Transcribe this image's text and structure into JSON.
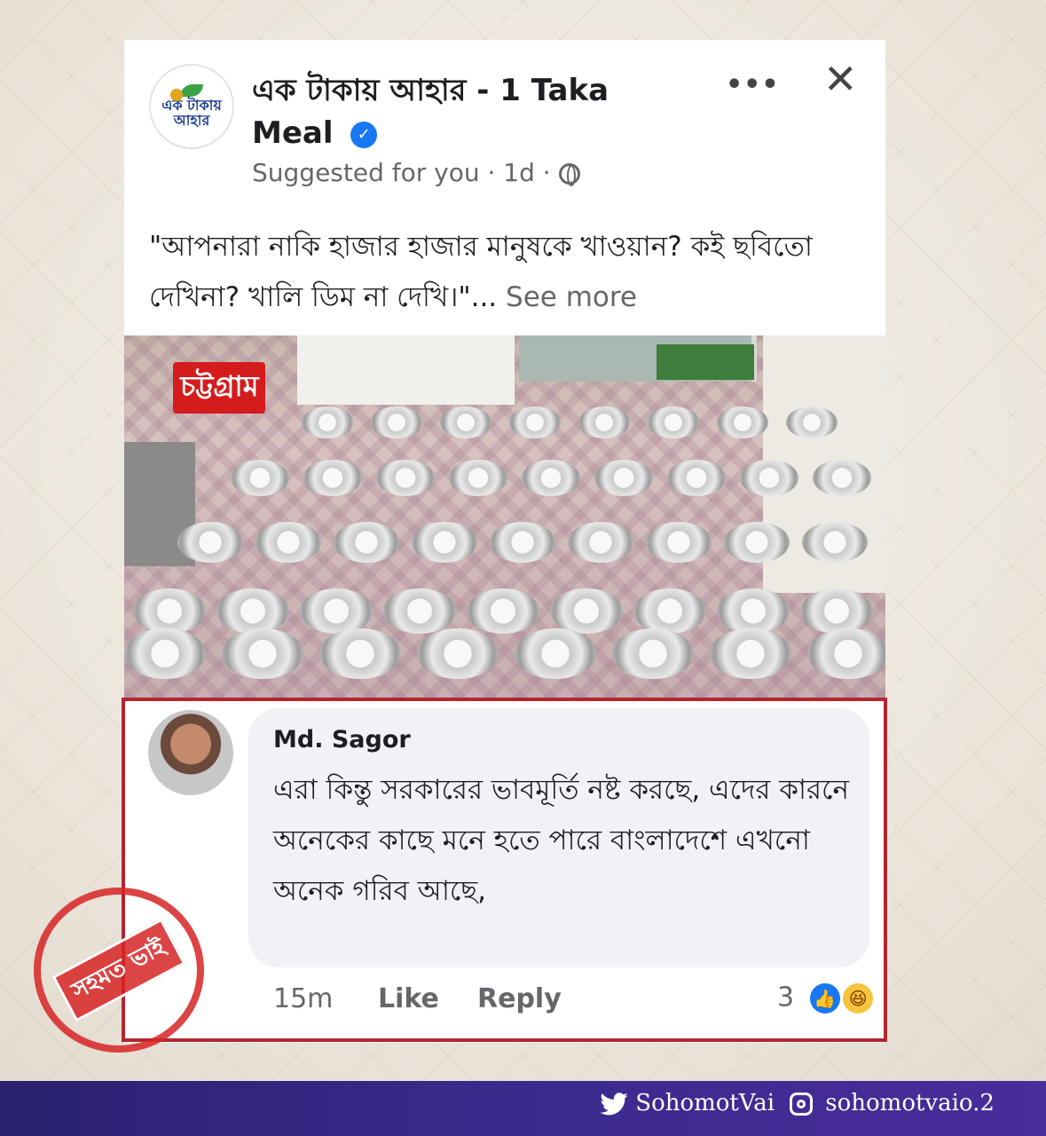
{
  "post": {
    "page_name": "এক টাকায় আহার - 1 Taka Meal",
    "avatar_text": "এক টাকায় আহার",
    "meta": "Suggested for you · 1d ·",
    "text": "\"আপনারা নাকি হাজার হাজার মানুষকে খাওয়ান? কই ছবিতো দেখিনা? খালি ডিম না দেখি।\"...",
    "see_more": "See more",
    "photo_label": "চট্টগ্রাম"
  },
  "comment": {
    "author": "Md. Sagor",
    "text": "এরা কিন্তু সরকারের ভাবমূর্তি নষ্ট করছে, এদের কারনে অনেকের কাছে মনে হতে পারে বাংলাদেশে এখনো অনেক গরিব আছে,",
    "time": "15m",
    "like_label": "Like",
    "reply_label": "Reply",
    "reaction_count": "3"
  },
  "stamp": {
    "text": "সহমত ভাই"
  },
  "footer": {
    "twitter": "SohomotVai",
    "instagram": "sohomotvaio.2"
  },
  "colors": {
    "accent_blue": "#1877f2",
    "frame_red": "#b3262d",
    "footer_purple": "#3b2a8d"
  }
}
